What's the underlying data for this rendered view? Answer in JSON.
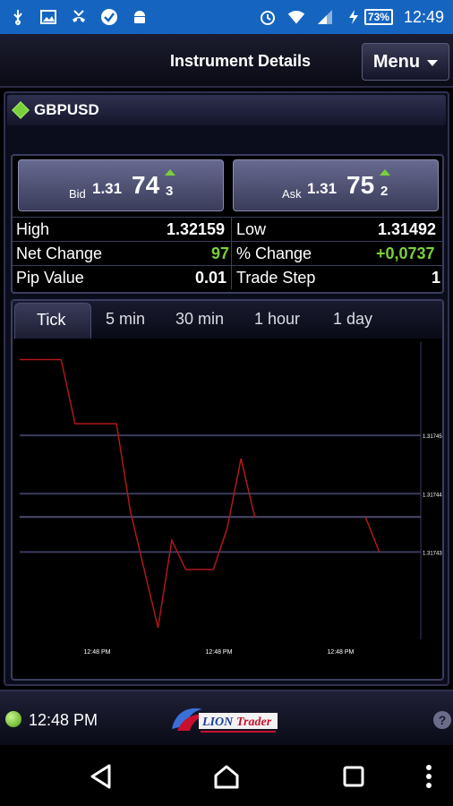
{
  "status_bar": {
    "battery": "73%",
    "time": "12:49",
    "icons_left": [
      "usb-icon",
      "image-icon",
      "missed-call-icon",
      "check-icon",
      "android-icon"
    ],
    "icons_right": [
      "alarm-icon",
      "wifi-icon",
      "signal-icon",
      "charging-icon"
    ]
  },
  "header": {
    "title": "Instrument Details",
    "menu_label": "Menu"
  },
  "instrument": {
    "symbol": "GBPUSD",
    "bid": {
      "label": "Bid",
      "big": "1.31",
      "pips": "74",
      "fraction": "3"
    },
    "ask": {
      "label": "Ask",
      "big": "1.31",
      "pips": "75",
      "fraction": "2"
    }
  },
  "stats": {
    "high_label": "High",
    "high_value": "1.32159",
    "low_label": "Low",
    "low_value": "1.31492",
    "net_change_label": "Net Change",
    "net_change_value": "97",
    "pct_change_label": "% Change",
    "pct_change_value": "+0,0737",
    "pip_value_label": "Pip Value",
    "pip_value": "0.01",
    "trade_step_label": "Trade Step",
    "trade_step_value": "1"
  },
  "chart": {
    "tabs": [
      "Tick",
      "5 min",
      "30 min",
      "1 hour",
      "1 day"
    ],
    "active_tab": "Tick"
  },
  "chart_data": {
    "type": "line",
    "title": "",
    "x_tick_labels": [
      "12:48 PM",
      "12:48 PM",
      "12:48 PM"
    ],
    "y_tick_labels": [
      "1.31745",
      "1.31744",
      "1.31743"
    ],
    "series": [
      {
        "color": "#b01818",
        "segments": [
          [
            [
              0,
              1.317463
            ],
            [
              1.5,
              1.317463
            ],
            [
              2,
              1.317452
            ],
            [
              3.5,
              1.317452
            ],
            [
              4,
              1.317437
            ],
            [
              5,
              1.317417
            ],
            [
              5.5,
              1.317432
            ],
            [
              6,
              1.317427
            ],
            [
              7,
              1.317427
            ],
            [
              7.5,
              1.317434
            ],
            [
              8,
              1.317446
            ],
            [
              8.5,
              1.317436
            ]
          ],
          [
            [
              12.5,
              1.317436
            ],
            [
              13,
              1.31743
            ]
          ]
        ]
      }
    ]
  },
  "footer": {
    "time": "12:48 PM",
    "logo_text": "LION Trader"
  },
  "colors": {
    "status_bar": "#1565c0",
    "positive": "#7ad03a",
    "chart_line": "#b01818"
  }
}
